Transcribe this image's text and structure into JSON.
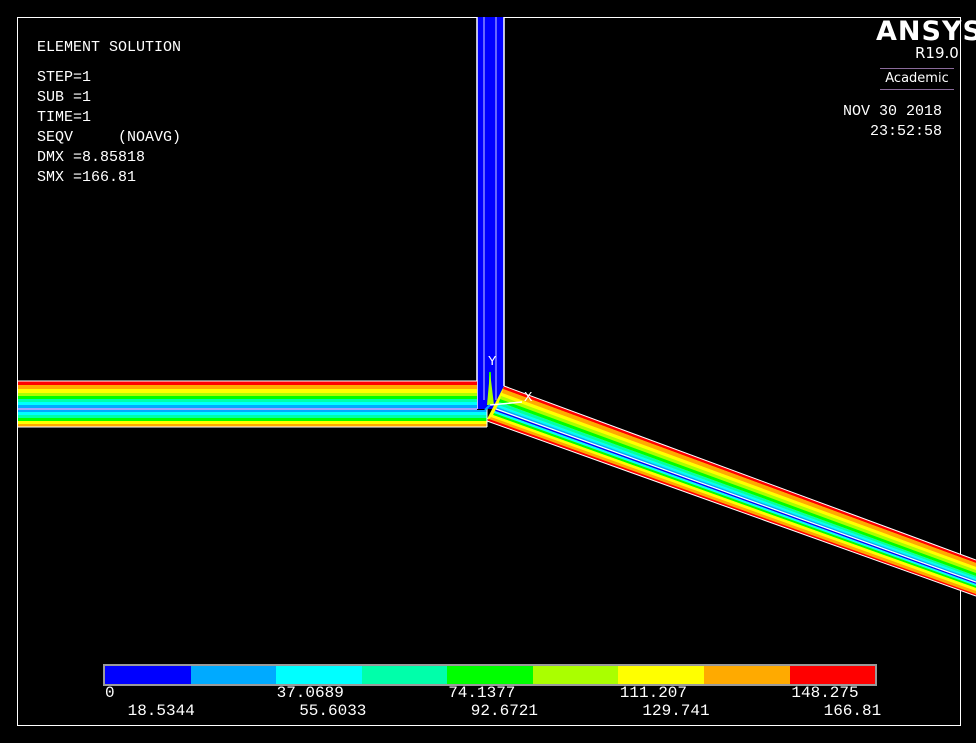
{
  "info": {
    "title": "ELEMENT SOLUTION",
    "step": "STEP=1",
    "sub": "SUB =1",
    "time": "TIME=1",
    "result": "SEQV     (NOAVG)",
    "dmx": "DMX =8.85818",
    "smx": "SMX =166.81"
  },
  "logo": {
    "name": "ANSYS",
    "version": "R19.0",
    "license": "Academic"
  },
  "datetime": {
    "date": "NOV 30 2018",
    "time": "23:52:58"
  },
  "axis_triad": {
    "y_label": "Y",
    "x_label": "X"
  },
  "legend": {
    "colors": [
      "#0000ff",
      "#00aaff",
      "#00ffff",
      "#00ffaa",
      "#00ff00",
      "#aaff00",
      "#ffff00",
      "#ffaa00",
      "#ff0000"
    ],
    "ticks_top": [
      "0",
      "37.0689",
      "74.1377",
      "111.207",
      "148.275"
    ],
    "ticks_bottom": [
      "18.5344",
      "55.6033",
      "92.6721",
      "129.741",
      "166.81"
    ]
  }
}
